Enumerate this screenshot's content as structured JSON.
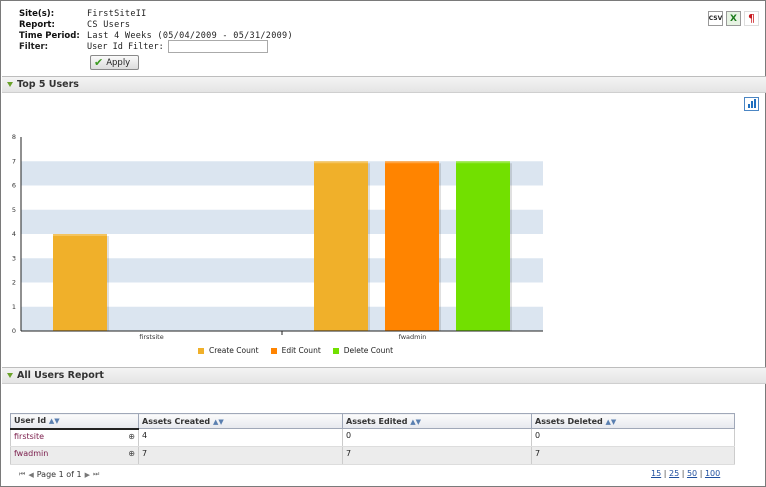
{
  "header": {
    "site_label": "Site(s):",
    "site_value": "FirstSiteII",
    "report_label": "Report:",
    "report_value": "CS Users",
    "period_label": "Time Period:",
    "period_value": "Last 4 Weeks (05/04/2009 - 05/31/2009)",
    "filter_label": "Filter:",
    "userid_filter_label": "User Id Filter:",
    "userid_filter_value": "",
    "apply_label": "Apply",
    "export": {
      "csv": "CSV",
      "xls": "X",
      "pdf": "¶"
    }
  },
  "sections": {
    "top5": "Top 5 Users",
    "all_users": "All Users Report"
  },
  "chart_data": {
    "type": "bar",
    "categories": [
      "firstsite",
      "fwadmin"
    ],
    "series": [
      {
        "name": "Create Count",
        "values": [
          4,
          7
        ],
        "color": "#f0b02a"
      },
      {
        "name": "Edit Count",
        "values": [
          0,
          7
        ],
        "color": "#ff8400"
      },
      {
        "name": "Delete Count",
        "values": [
          0,
          7
        ],
        "color": "#72e000"
      }
    ],
    "ylim": [
      0,
      8
    ],
    "yticks": [
      "0",
      "1",
      "2",
      "3",
      "4",
      "5",
      "6",
      "7",
      "8"
    ],
    "grid": "alternating horizontal bands",
    "legend": "bottom-center"
  },
  "table": {
    "columns": [
      "User Id",
      "Assets Created",
      "Assets Edited",
      "Assets Deleted"
    ],
    "rows": [
      [
        "firstsite",
        "4",
        "0",
        "0"
      ],
      [
        "fwadmin",
        "7",
        "7",
        "7"
      ]
    ]
  },
  "pager": {
    "text": "Page 1 of 1",
    "sizes": [
      "15",
      "25",
      "50",
      "100"
    ],
    "sep": "|"
  }
}
